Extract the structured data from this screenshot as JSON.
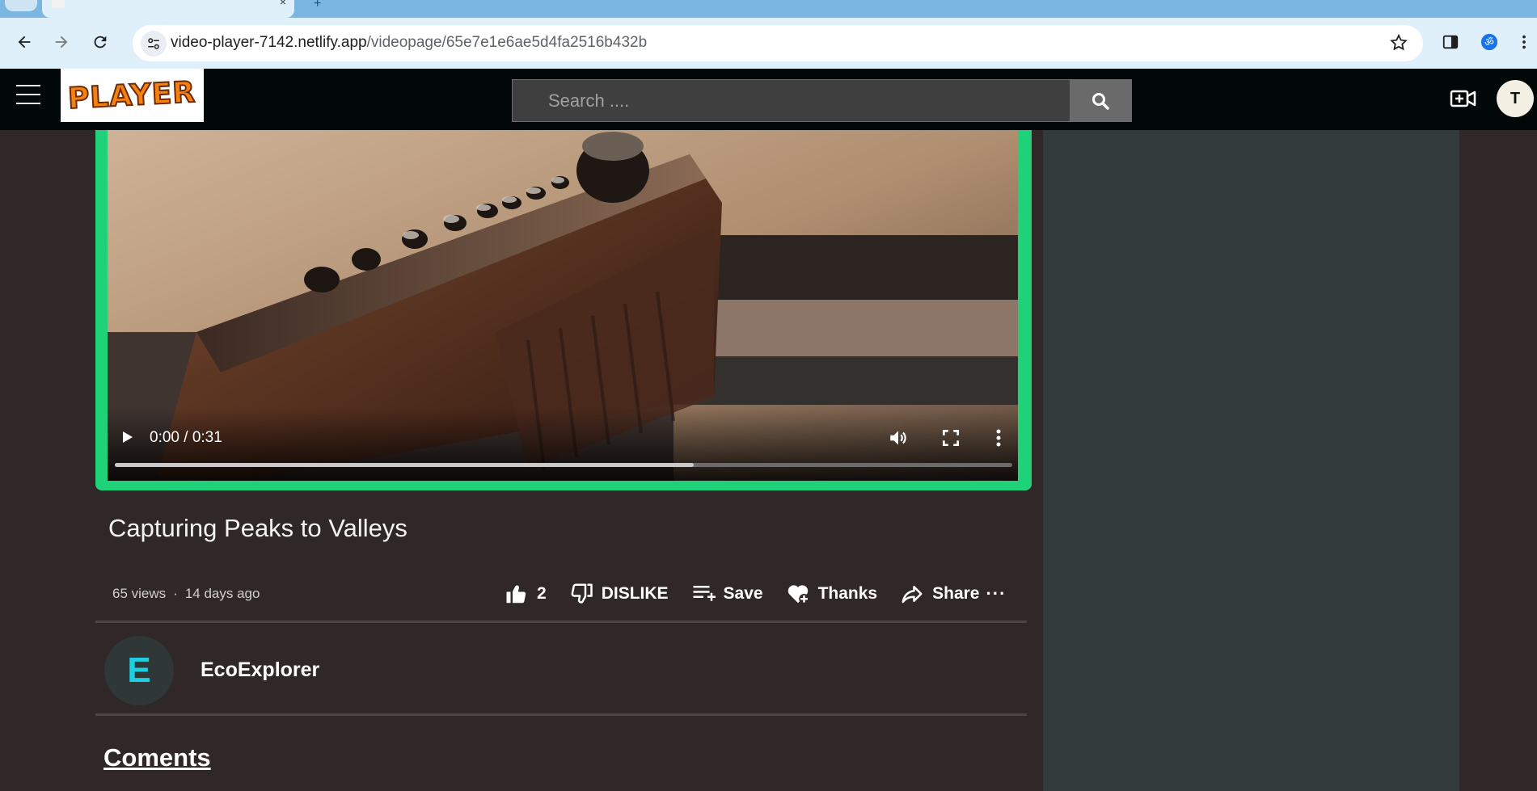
{
  "browser": {
    "url_host": "video-player-7142.netlify.app",
    "url_path": "/videopage/65e7e1e6ae5d4fa2516b432b",
    "icons": [
      "back-icon",
      "forward-icon",
      "reload-icon",
      "site-info-icon",
      "bookmark-star-icon",
      "side-panel-icon",
      "extension-om-icon",
      "browser-menu-icon"
    ]
  },
  "header": {
    "logo_text": "PLAYER",
    "search_placeholder": "Search ....",
    "user_initial": "T"
  },
  "video": {
    "time_display": "0:00 / 0:31",
    "progress_fraction": 0.645,
    "title": "Capturing Peaks to Valleys",
    "views": "65 views",
    "dot": "·",
    "age": "14 days ago"
  },
  "actions": {
    "like_count": "2",
    "dislike_label": "DISLIKE",
    "save_label": "Save",
    "thanks_label": "Thanks",
    "share_label": "Share",
    "more_label": "···"
  },
  "channel": {
    "initial": "E",
    "name": "EcoExplorer"
  },
  "comments": {
    "title": "Coments"
  },
  "colors": {
    "accent_green": "#1fd27a",
    "page_bg": "#302728",
    "side_panel": "#323b39",
    "channel_initial": "#1ecfe2",
    "logo_orange": "#f5820f"
  }
}
